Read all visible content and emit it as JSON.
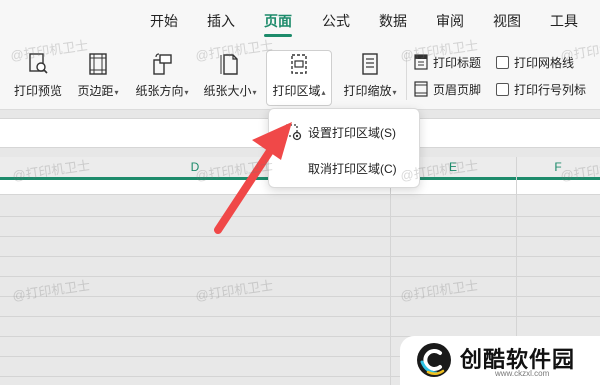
{
  "menu": {
    "items": [
      "开始",
      "插入",
      "页面",
      "公式",
      "数据",
      "审阅",
      "视图",
      "工具"
    ],
    "active_index": 2,
    "accent_color": "#1d8b6b"
  },
  "ribbon": {
    "print_preview": "打印预览",
    "margins": "页边距",
    "orientation": "纸张方向",
    "paper_size": "纸张大小",
    "print_area": "打印区域",
    "print_scale": "打印缩放",
    "print_titles": "打印标题",
    "header_footer": "页眉页脚",
    "print_gridlines": "打印网格线",
    "print_row_col_headers": "打印行号列标"
  },
  "dropdown": {
    "set_print_area": "设置打印区域(S)",
    "clear_print_area": "取消打印区域(C)"
  },
  "columns": [
    "D",
    "E",
    "F"
  ],
  "watermark": "@打印机卫士",
  "logo": {
    "name": "创酷软件园",
    "url": "www.ckzxl.com"
  }
}
